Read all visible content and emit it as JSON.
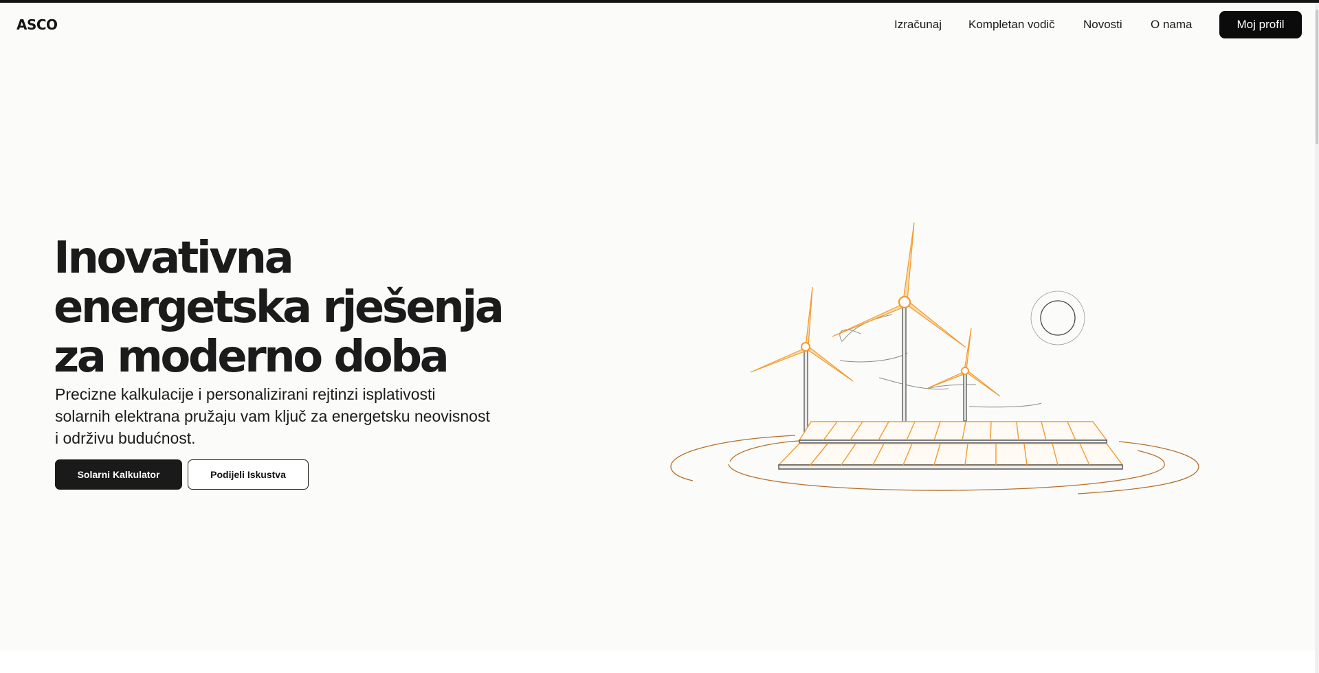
{
  "brand": {
    "logo": "ASCO"
  },
  "nav": {
    "links": [
      "Izračunaj",
      "Kompletan vodič",
      "Novosti",
      "O nama"
    ],
    "profile_label": "Moj profil"
  },
  "hero": {
    "title_lines": [
      "Inovativna",
      "energetska rješenja",
      "za moderno doba"
    ],
    "subtitle_lines": [
      "Precizne kalkulacije i personalizirani rejtinzi isplativosti",
      "solarnih elektrana pružaju vam ključ za energetsku neovisnost",
      "i održivu budućnost."
    ],
    "primary_button": "Solarni Kalkulator",
    "secondary_button": "Podijeli Iskustva"
  },
  "illustration": {
    "description_icon": "wind-solar-illustration-icon",
    "accent_color": "#f5a03c",
    "panel_color": "#f39a2e",
    "ring_color": "#b5702c"
  }
}
